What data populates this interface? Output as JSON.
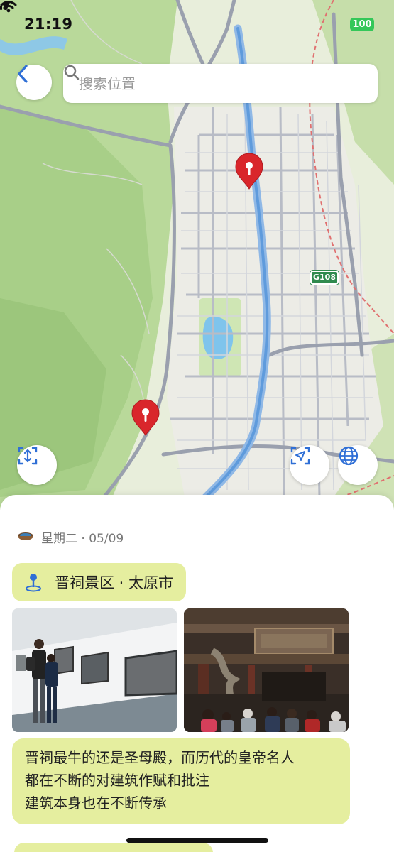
{
  "status_bar": {
    "time": "21:19",
    "battery": "100"
  },
  "search": {
    "placeholder": "搜索位置"
  },
  "map": {
    "highway_label": "G108"
  },
  "entry": {
    "date": "星期二 · 05/09",
    "location": "晋祠景区 · 太原市",
    "note_lines": [
      "晋祠最牛的还是圣母殿，而历代的皇帝名人",
      "都在不断的对建筑作赋和批注",
      "建筑本身也在不断传承"
    ]
  },
  "colors": {
    "accent": "#2f6fd6",
    "pin_red": "#d9262b",
    "bubble": "#e5ee9f",
    "highway_green": "#2f8a4e",
    "battery_green": "#34c759"
  },
  "icons": [
    "back-chevron-icon",
    "search-icon",
    "location-arrow-icon",
    "wifi-icon",
    "fit-bounds-icon",
    "locate-icon",
    "globe-icon",
    "map-pin-icon",
    "bowl-icon"
  ]
}
